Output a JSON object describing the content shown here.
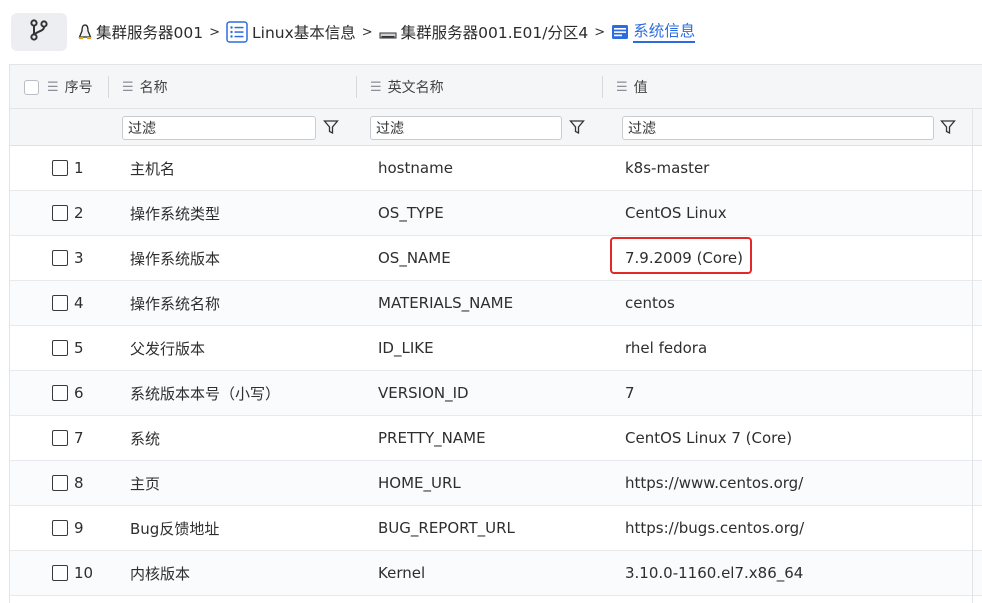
{
  "breadcrumb": {
    "items": [
      {
        "label": "集群服务器001",
        "icon": "linux-tux-icon"
      },
      {
        "label": "Linux基本信息",
        "icon": "list-icon"
      },
      {
        "label": "集群服务器001.E01/分区4",
        "icon": "partition-icon"
      },
      {
        "label": "系统信息",
        "icon": "info-table-icon"
      }
    ],
    "separator": ">"
  },
  "table": {
    "columns": [
      {
        "label": "序号"
      },
      {
        "label": "名称"
      },
      {
        "label": "英文名称"
      },
      {
        "label": "值"
      }
    ],
    "filter_placeholder": "过滤",
    "rows": [
      {
        "index": "1",
        "name": "主机名",
        "english": "hostname",
        "value": "k8s-master"
      },
      {
        "index": "2",
        "name": "操作系统类型",
        "english": "OS_TYPE",
        "value": "CentOS Linux"
      },
      {
        "index": "3",
        "name": "操作系统版本",
        "english": "OS_NAME",
        "value": "7.9.2009 (Core)"
      },
      {
        "index": "4",
        "name": "操作系统名称",
        "english": "MATERIALS_NAME",
        "value": "centos"
      },
      {
        "index": "5",
        "name": "父发行版本",
        "english": "ID_LIKE",
        "value": "rhel fedora"
      },
      {
        "index": "6",
        "name": "系统版本本号（小写）",
        "english": "VERSION_ID",
        "value": "7"
      },
      {
        "index": "7",
        "name": "系统",
        "english": "PRETTY_NAME",
        "value": "CentOS Linux 7 (Core)"
      },
      {
        "index": "8",
        "name": "主页",
        "english": "HOME_URL",
        "value": "https://www.centos.org/"
      },
      {
        "index": "9",
        "name": "Bug反馈地址",
        "english": "BUG_REPORT_URL",
        "value": "https://bugs.centos.org/"
      },
      {
        "index": "10",
        "name": "内核版本",
        "english": "Kernel",
        "value": "3.10.0-1160.el7.x86_64"
      }
    ]
  },
  "colors": {
    "accent": "#2d6cdf",
    "highlight": "#e02a2a"
  }
}
